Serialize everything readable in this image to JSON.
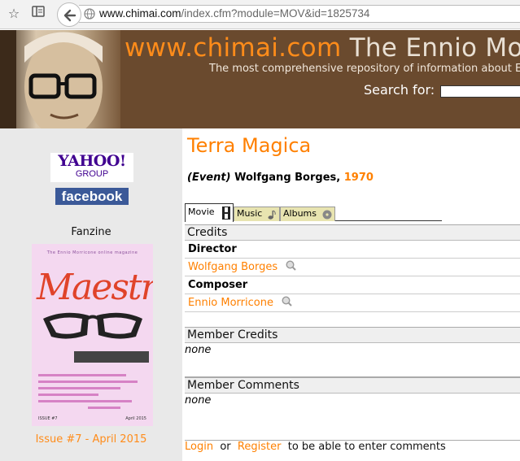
{
  "browser": {
    "url_host": "www.chimai.com",
    "url_path": "/index.cfm?module=MOV&id=1825734"
  },
  "header": {
    "site_name": "www.chimai.com",
    "site_subtitle": "The Ennio Mo",
    "tagline": "The most comprehensive repository of information about Enn",
    "search_label": "Search for:",
    "search_value": ""
  },
  "sidebar": {
    "yahoo_line1": "YAHOO!",
    "yahoo_line2": "GROUP",
    "facebook": "facebook",
    "fanzine_label": "Fanzine",
    "magazine": {
      "top_line": "The Ennio Morricone online magazine",
      "title": "Maestro",
      "issue": "ISSUE #7",
      "date": "April 2015"
    },
    "issue_link": "Issue #7 - April 2015"
  },
  "movie": {
    "title": "Terra Magica",
    "type": "(Event)",
    "person": "Wolfgang Borges,",
    "year": "1970"
  },
  "tabs": [
    {
      "label": "Movie"
    },
    {
      "label": "Music"
    },
    {
      "label": "Albums"
    }
  ],
  "credits": {
    "heading": "Credits",
    "director_role": "Director",
    "director_name": "Wolfgang Borges",
    "composer_role": "Composer",
    "composer_name": "Ennio Morricone"
  },
  "member_credits": {
    "heading": "Member Credits",
    "value": "none"
  },
  "member_comments": {
    "heading": "Member Comments",
    "value": "none"
  },
  "login_line": {
    "login": "Login",
    "or": "or",
    "register": "Register",
    "suffix": "to be able to enter comments"
  },
  "colors": {
    "accent": "#ff8000",
    "banner": "#6a4a2e",
    "sidebar": "#e9e9e9"
  }
}
